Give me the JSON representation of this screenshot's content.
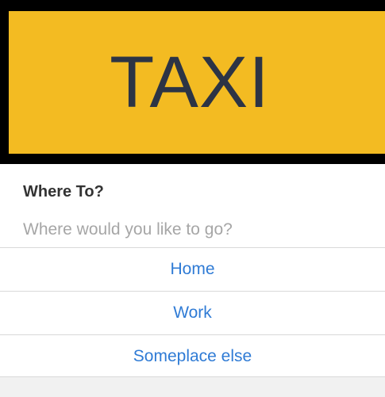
{
  "banner": {
    "text": "TAXI",
    "background_color": "#f3bb22",
    "border_color": "#000000",
    "text_color": "#2c3445"
  },
  "dialog": {
    "title": "Where To?",
    "subtitle": "Where would you like to go?",
    "options": [
      {
        "label": "Home"
      },
      {
        "label": "Work"
      },
      {
        "label": "Someplace else"
      }
    ],
    "link_color": "#2f7bd5"
  }
}
